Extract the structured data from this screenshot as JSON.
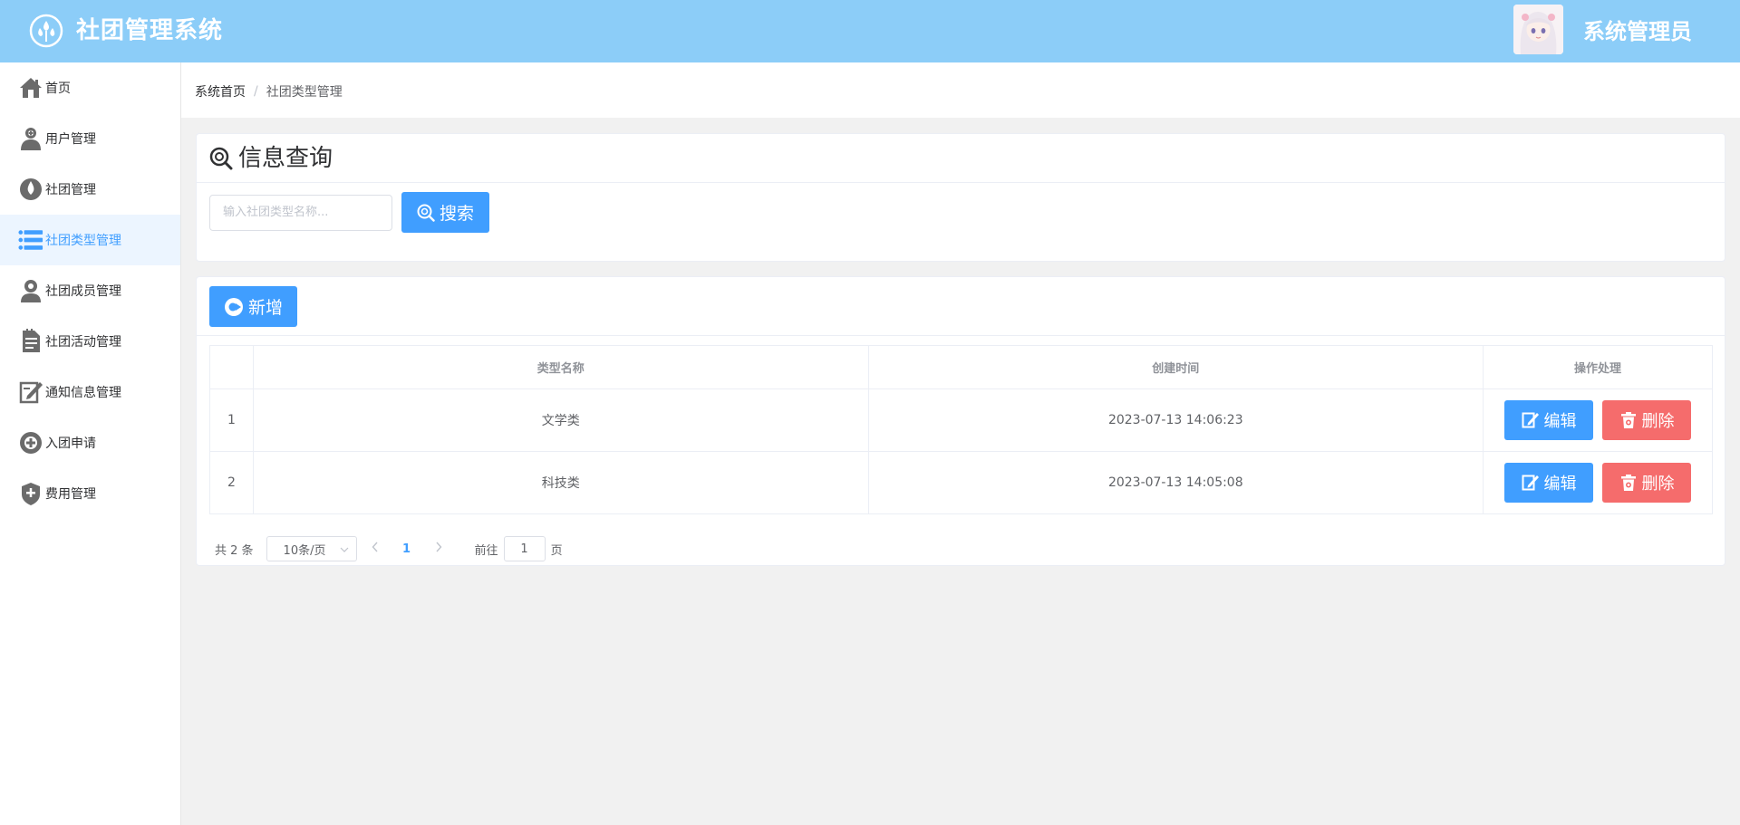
{
  "header": {
    "app_title": "社团管理系统",
    "user_name": "系统管理员",
    "bg_color": "#8ccdf8"
  },
  "sidebar": {
    "items": [
      {
        "label": "首页",
        "icon": "home-icon",
        "active": false
      },
      {
        "label": "用户管理",
        "icon": "user-add-icon",
        "active": false
      },
      {
        "label": "社团管理",
        "icon": "drop-icon",
        "active": false
      },
      {
        "label": "社团类型管理",
        "icon": "list-icon",
        "active": true
      },
      {
        "label": "社团成员管理",
        "icon": "member-icon",
        "active": false
      },
      {
        "label": "社团活动管理",
        "icon": "document-icon",
        "active": false
      },
      {
        "label": "通知信息管理",
        "icon": "edit-note-icon",
        "active": false
      },
      {
        "label": "入团申请",
        "icon": "plus-circle-icon",
        "active": false
      },
      {
        "label": "费用管理",
        "icon": "shield-badge-icon",
        "active": false
      }
    ],
    "active_color": "#409eff"
  },
  "breadcrumb": {
    "home": "系统首页",
    "separator": "/",
    "current": "社团类型管理"
  },
  "search_card": {
    "title": "信息查询",
    "input_placeholder": "输入社团类型名称...",
    "search_label": "搜索"
  },
  "table_card": {
    "add_label": "新增",
    "columns": [
      "",
      "类型名称",
      "创建时间",
      "操作处理"
    ],
    "rows": [
      {
        "index": "1",
        "name": "文学类",
        "created": "2023-07-13 14:06:23"
      },
      {
        "index": "2",
        "name": "科技类",
        "created": "2023-07-13 14:05:08"
      }
    ],
    "edit_label": "编辑",
    "delete_label": "删除",
    "primary_color": "#409eff",
    "danger_color": "#f56c6c"
  },
  "pagination": {
    "total_text": "共 2 条",
    "page_size": "10条/页",
    "current_page": "1",
    "goto_prefix": "前往",
    "goto_value": "1",
    "goto_suffix": "页"
  }
}
